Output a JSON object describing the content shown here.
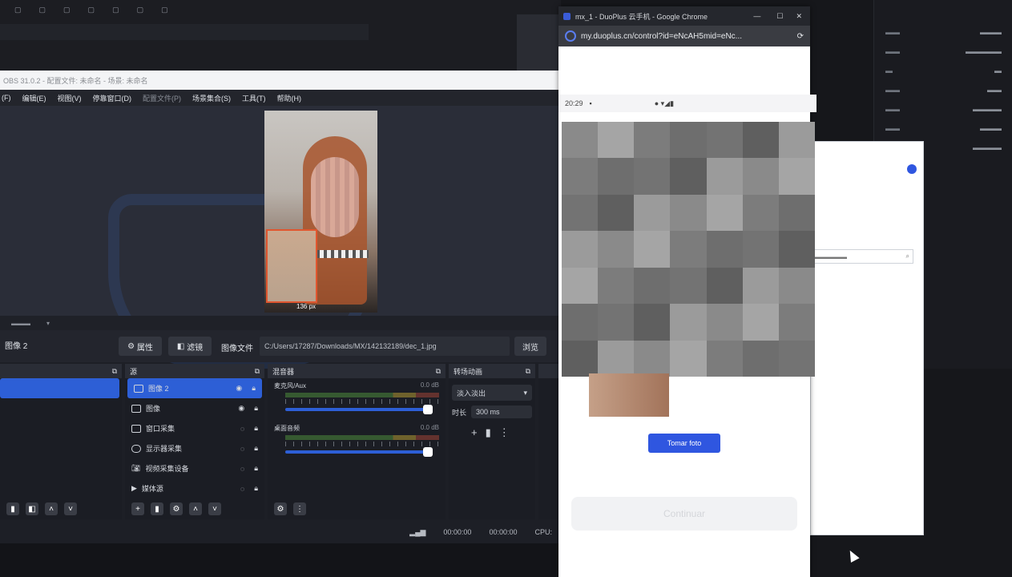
{
  "obs": {
    "title": "OBS 31.0.2 - 配置文件: 未命名 - 场景: 未命名",
    "menu": [
      "(F)",
      "编辑(E)",
      "视图(V)",
      "停靠窗口(D)",
      "配置文件(P)",
      "场景集合(S)",
      "工具(T)",
      "帮助(H)"
    ],
    "preview_size_label": "136 px",
    "scene_label": "图像 2",
    "buttons": {
      "properties": "属性",
      "filters": "滤镜",
      "browse": "浏览"
    },
    "image_file_label": "图像文件",
    "image_path": "C:/Users/17287/Downloads/MX/142132189/dec_1.jpg",
    "docks": {
      "sources": {
        "title": "源",
        "items": [
          {
            "label": "图像 2",
            "selected": true,
            "icon": "image-icon"
          },
          {
            "label": "图像",
            "selected": false,
            "icon": "image-icon"
          },
          {
            "label": "窗口采集",
            "selected": false,
            "icon": "window-icon"
          },
          {
            "label": "显示器采集",
            "selected": false,
            "icon": "monitor-icon"
          },
          {
            "label": "视频采集设备",
            "selected": false,
            "icon": "camera-icon"
          },
          {
            "label": "媒体源",
            "selected": false,
            "icon": "play-icon"
          }
        ]
      },
      "mixer": {
        "title": "混音器",
        "channels": [
          {
            "name": "麦克风/Aux",
            "db": "0.0 dB"
          },
          {
            "name": "桌面音频",
            "db": "0.0 dB"
          }
        ]
      },
      "transitions": {
        "title": "转场动画",
        "selected": "淡入淡出",
        "duration_label": "时长",
        "duration": "300 ms"
      }
    },
    "status": {
      "time1": "00:00:00",
      "time2": "00:00:00",
      "cpu": "CPU:"
    }
  },
  "chrome": {
    "title": "mx_1 - DuoPlus 云手机 - Google Chrome",
    "url": "my.duoplus.cn/control?id=eNcAH5mid=eNc...",
    "phone_time": "20:29",
    "foto_button": "Tomar foto",
    "continue_button": "Continuar"
  },
  "colors": {
    "accent": "#2d5fd6",
    "dock": "#1b1d24",
    "panel": "#2a2d36"
  }
}
